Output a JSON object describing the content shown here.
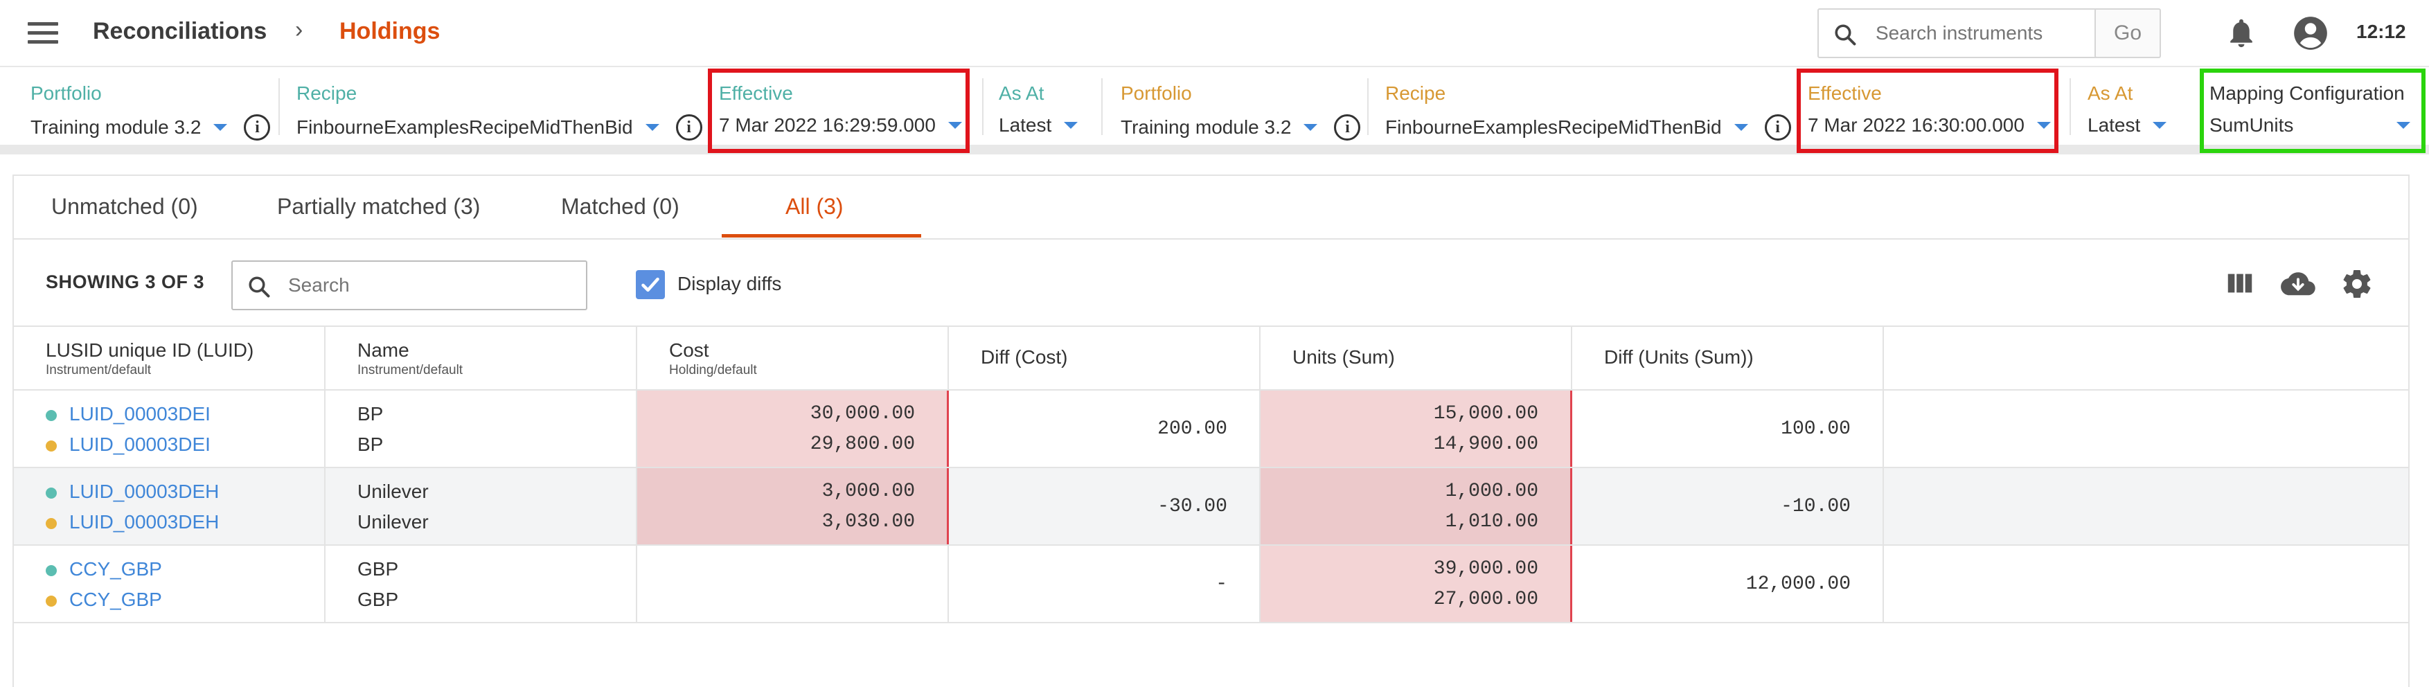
{
  "header": {
    "title": "Reconciliations",
    "separator": "›",
    "page": "Holdings",
    "search_placeholder": "Search instruments",
    "go_label": "Go",
    "time": "12:12"
  },
  "config": {
    "left": [
      {
        "label": "Portfolio",
        "value": "Training module 3.2"
      },
      {
        "label": "Recipe",
        "value": "FinbourneExamplesRecipeMidThenBid"
      },
      {
        "label": "Effective",
        "value": "7 Mar 2022 16:29:59.000"
      },
      {
        "label": "As At",
        "value": "Latest"
      }
    ],
    "right": [
      {
        "label": "Portfolio",
        "value": "Training module 3.2"
      },
      {
        "label": "Recipe",
        "value": "FinbourneExamplesRecipeMidThenBid"
      },
      {
        "label": "Effective",
        "value": "7 Mar 2022 16:30:00.000"
      },
      {
        "label": "As At",
        "value": "Latest"
      }
    ],
    "mapping": {
      "label": "Mapping Configuration",
      "value": "SumUnits"
    },
    "colors": {
      "left_label": "#4fb0a6",
      "right_label": "#d79833",
      "highlight_red": "#e0141c",
      "highlight_green": "#2bd40d"
    }
  },
  "tabs": [
    {
      "label": "Unmatched (0)"
    },
    {
      "label": "Partially matched (3)"
    },
    {
      "label": "Matched (0)"
    },
    {
      "label": "All (3)",
      "active": true
    }
  ],
  "toolbar": {
    "showing": "SHOWING 3 OF 3",
    "search_placeholder": "Search",
    "display_diffs_label": "Display diffs",
    "display_diffs_checked": true,
    "icons": [
      "columns-icon",
      "cloud-download-icon",
      "settings-icon"
    ]
  },
  "table": {
    "columns": [
      {
        "label": "LUSID unique ID (LUID)",
        "sub": "Instrument/default"
      },
      {
        "label": "Name",
        "sub": "Instrument/default"
      },
      {
        "label": "Cost",
        "sub": "Holding/default"
      },
      {
        "label": "Diff (Cost)",
        "sub": ""
      },
      {
        "label": "Units (Sum)",
        "sub": ""
      },
      {
        "label": "Diff (Units (Sum))",
        "sub": ""
      }
    ],
    "rows": [
      {
        "luid": [
          "LUID_00003DEI",
          "LUID_00003DEI"
        ],
        "name": [
          "BP",
          "BP"
        ],
        "cost": [
          "30,000.00",
          "29,800.00"
        ],
        "diff_cost": "200.00",
        "units": [
          "15,000.00",
          "14,900.00"
        ],
        "diff_units": "100.00"
      },
      {
        "luid": [
          "LUID_00003DEH",
          "LUID_00003DEH"
        ],
        "name": [
          "Unilever",
          "Unilever"
        ],
        "cost": [
          "3,000.00",
          "3,030.00"
        ],
        "diff_cost": "-30.00",
        "units": [
          "1,000.00",
          "1,010.00"
        ],
        "diff_units": "-10.00"
      },
      {
        "luid": [
          "CCY_GBP",
          "CCY_GBP"
        ],
        "name": [
          "GBP",
          "GBP"
        ],
        "cost": [
          "",
          ""
        ],
        "diff_cost": "-",
        "units": [
          "39,000.00",
          "27,000.00"
        ],
        "diff_units": "12,000.00"
      }
    ]
  }
}
